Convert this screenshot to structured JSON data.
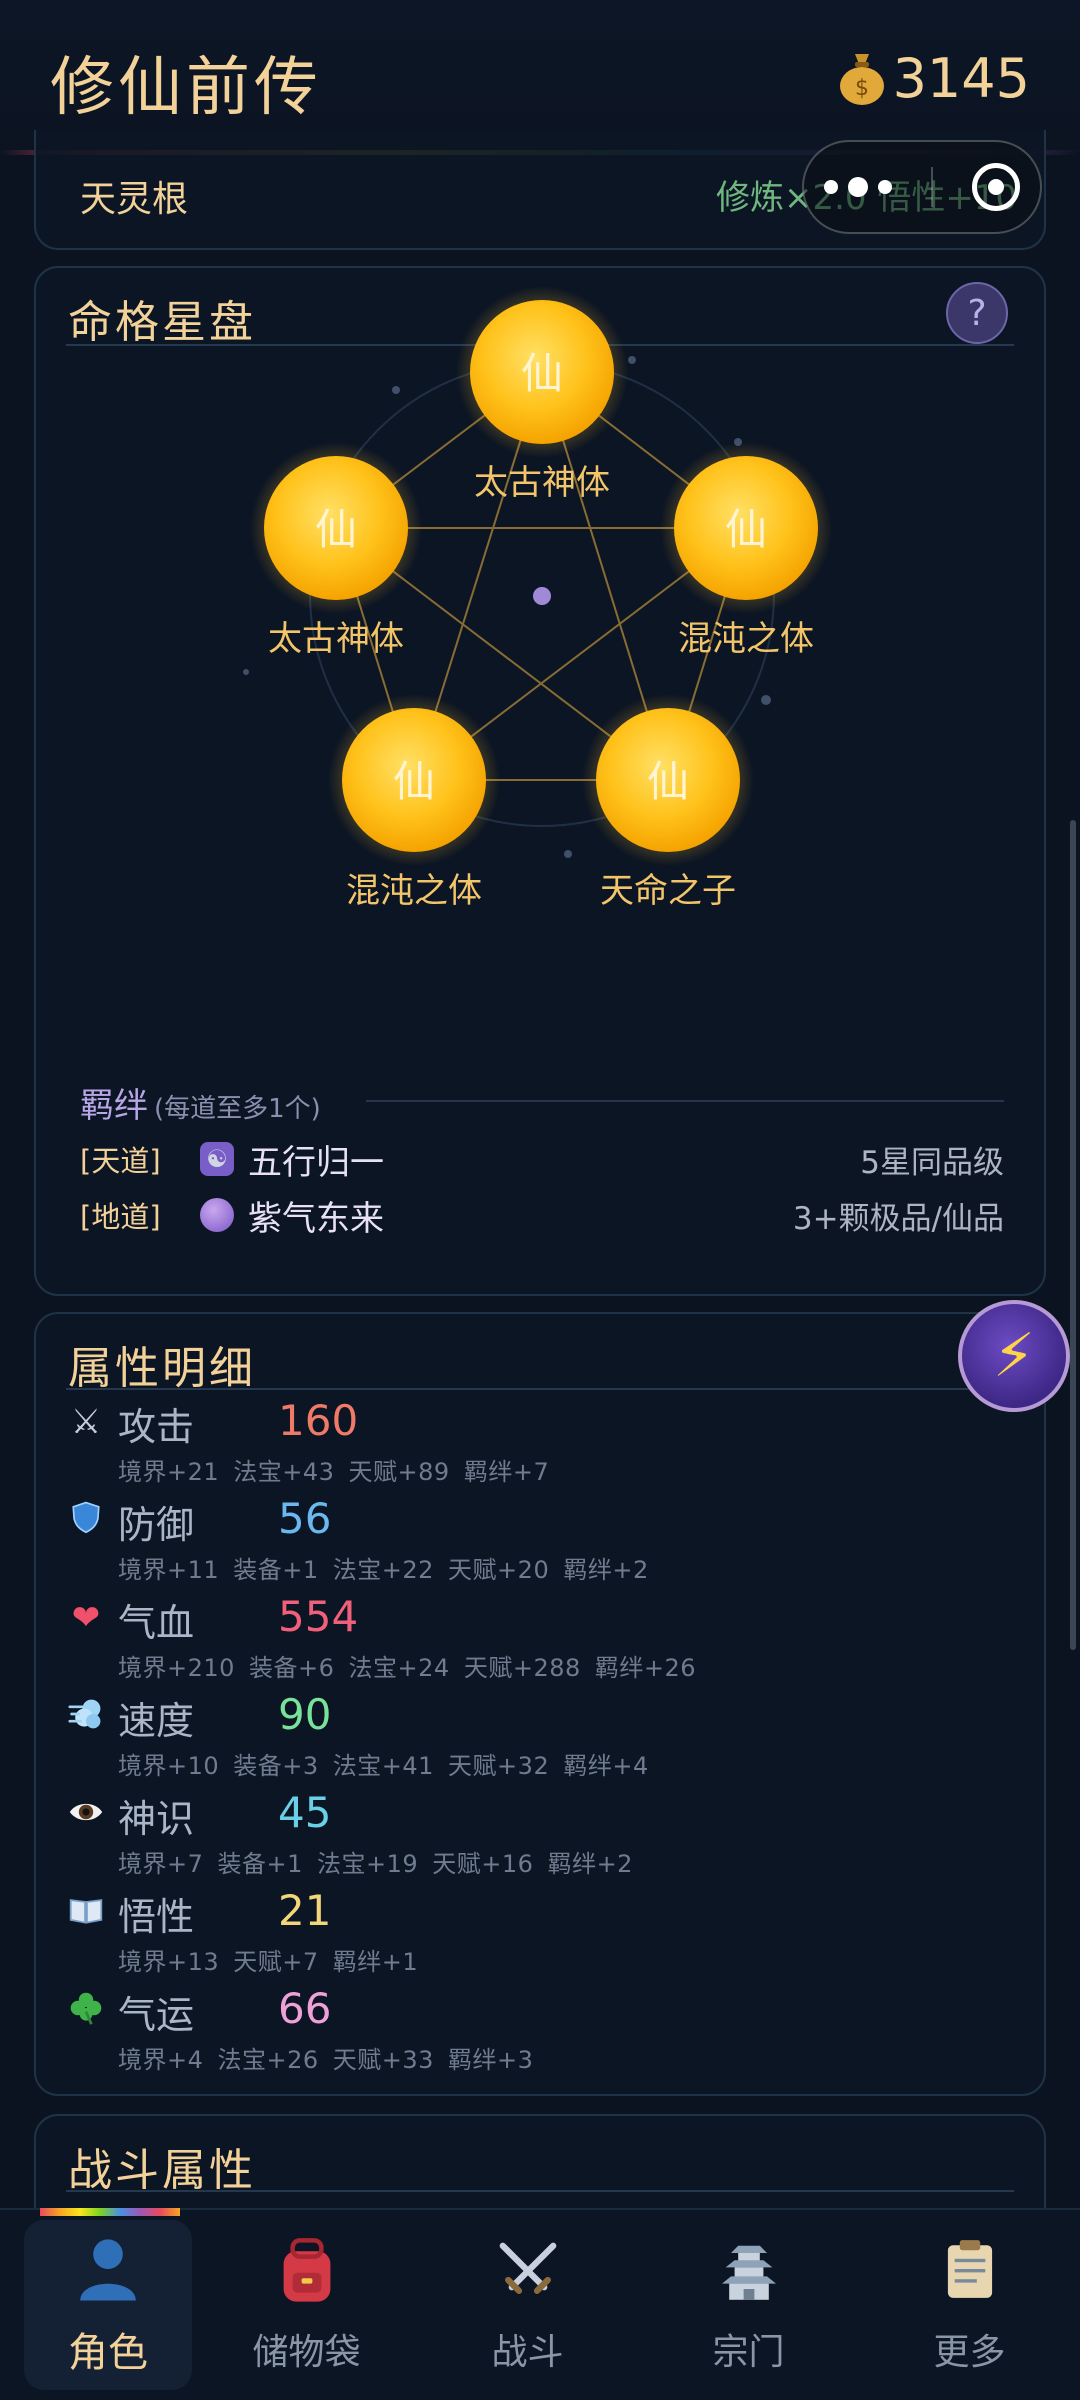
{
  "app": {
    "title": "修仙前传",
    "coins": "3145",
    "coin_icon": "money-bag-icon"
  },
  "root": {
    "label": "天灵根",
    "bonus": "修炼×2.0 悟性+10"
  },
  "star_chart": {
    "title": "命格星盘",
    "help_label": "?",
    "nodes": [
      {
        "glyph": "仙",
        "label": "太古神体"
      },
      {
        "glyph": "仙",
        "label": "混沌之体"
      },
      {
        "glyph": "仙",
        "label": "天命之子"
      },
      {
        "glyph": "仙",
        "label": "混沌之体"
      },
      {
        "glyph": "仙",
        "label": "太古神体"
      }
    ]
  },
  "bonds": {
    "title": "羁绊",
    "note": "(每道至多1个)",
    "rows": [
      {
        "tag": "[天道]",
        "icon": "yin-yang-icon",
        "name": "五行归一",
        "requirement": "5星同品级"
      },
      {
        "tag": "[地道]",
        "icon": "crystal-ball-icon",
        "name": "紫气东来",
        "requirement": "3+颗极品/仙品"
      }
    ]
  },
  "attributes": {
    "title": "属性明细",
    "items": [
      {
        "icon": "crossed-swords-icon",
        "glyph": "⚔",
        "name": "攻击",
        "value": "160",
        "color": "#f07a68",
        "detail": "境界+21 法宝+43 天赋+89 羁绊+7"
      },
      {
        "icon": "shield-icon",
        "glyph": "🛡",
        "name": "防御",
        "value": "56",
        "color": "#6ab8f0",
        "detail": "境界+11 装备+1 法宝+22 天赋+20 羁绊+2"
      },
      {
        "icon": "heart-icon",
        "glyph": "❤",
        "name": "气血",
        "value": "554",
        "color": "#f0607a",
        "detail": "境界+210 装备+6 法宝+24 天赋+288 羁绊+26"
      },
      {
        "icon": "wind-icon",
        "glyph": "💨",
        "name": "速度",
        "value": "90",
        "color": "#79e29a",
        "detail": "境界+10 装备+3 法宝+41 天赋+32 羁绊+4"
      },
      {
        "icon": "eye-icon",
        "glyph": "👁",
        "name": "神识",
        "value": "45",
        "color": "#6ad0e8",
        "detail": "境界+7 装备+1 法宝+19 天赋+16 羁绊+2"
      },
      {
        "icon": "book-icon",
        "glyph": "📖",
        "name": "悟性",
        "value": "21",
        "color": "#f3d67a",
        "detail": "境界+13 天赋+7 羁绊+1"
      },
      {
        "icon": "clover-icon",
        "glyph": "✤",
        "name": "气运",
        "value": "66",
        "color": "#f0a0d8",
        "detail": "境界+4 法宝+26 天赋+33 羁绊+3"
      }
    ]
  },
  "combat": {
    "title": "战斗属性"
  },
  "fab": {
    "icon": "lightning-icon",
    "glyph": "⚡"
  },
  "tabs": [
    {
      "label": "角色",
      "icon": "person-icon",
      "glyph": "👤",
      "active": true
    },
    {
      "label": "储物袋",
      "icon": "backpack-icon",
      "glyph": "🎒",
      "active": false
    },
    {
      "label": "战斗",
      "icon": "crossed-swords-icon",
      "glyph": "⚔",
      "active": false
    },
    {
      "label": "宗门",
      "icon": "pagoda-icon",
      "glyph": "🏯",
      "active": false
    },
    {
      "label": "更多",
      "icon": "clipboard-icon",
      "glyph": "📋",
      "active": false
    }
  ],
  "colors": {
    "gold": "#f3d29a",
    "orb": "#ffc51a",
    "accent_purple": "#6d4bc4"
  }
}
